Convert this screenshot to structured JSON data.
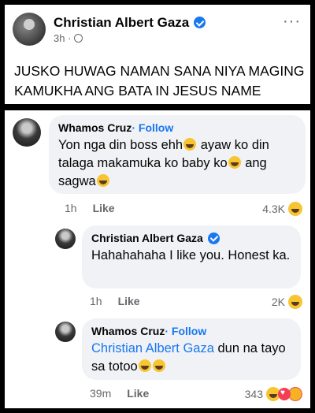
{
  "post": {
    "author": "Christian Albert Gaza",
    "time": "3h ·",
    "more": "···",
    "text": "JUSKO HUWAG NAMAN SANA NIYA MAGING KAMUKHA ANG BATA IN JESUS NAME"
  },
  "comments": [
    {
      "author": "Whamos Cruz",
      "follow": " · Follow",
      "text_1": "Yon nga din boss ehh",
      "text_2": " ayaw ko din talaga makamuka ko baby ko",
      "text_3": " ang sagwa",
      "time": "1h",
      "like": "Like",
      "reactions": "4.3K"
    },
    {
      "author": "Christian Albert Gaza",
      "text": "Hahahahaha I like you. Honest ka.",
      "time": "1h",
      "like": "Like",
      "reactions": "2K"
    },
    {
      "author": "Whamos Cruz",
      "follow": " · Follow",
      "mention": "Christian Albert Gaza",
      "text": " dun na tayo sa totoo",
      "time": "39m",
      "like": "Like",
      "reactions": "343"
    }
  ]
}
